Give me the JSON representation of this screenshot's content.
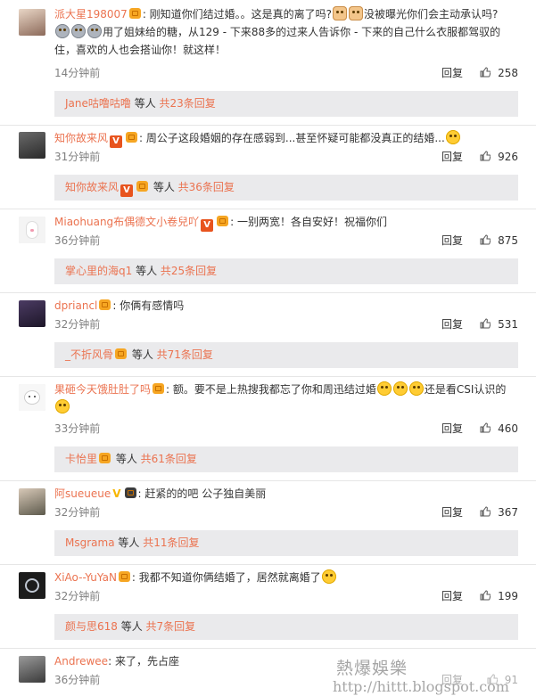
{
  "comments": [
    {
      "user": "派大星198007",
      "text_a": "刚知道你们结过婚。。这是真的离了吗?",
      "text_b": "没被曝光你们会主动承认吗?",
      "text_c": "用了姐妹给的糖，从129 - 下来88多的过来人告诉你 - 下来的自己什么衣服都驾驭的",
      "text_d": "住，喜欢的人也会搭讪你！就这样！",
      "time": "14分钟前",
      "reply": "回复",
      "likes": "258",
      "sub_user": "Jane咕噜咕噜",
      "sub_etc": " 等人 ",
      "sub_count": "共23条回复"
    },
    {
      "user": "知你故来风",
      "text_a": "周公子这段婚姻的存在感弱到...甚至怀疑可能都没真正的结婚...",
      "time": "31分钟前",
      "reply": "回复",
      "likes": "926",
      "sub_user": "知你故来风",
      "sub_etc": " 等人 ",
      "sub_count": "共36条回复"
    },
    {
      "user": "Miaohuang布偶德文小卷兒吖",
      "text_a": "一别两宽！各自安好！祝福你们",
      "time": "36分钟前",
      "reply": "回复",
      "likes": "875",
      "sub_user": "掌心里的海q1",
      "sub_etc": " 等人 ",
      "sub_count": "共25条回复"
    },
    {
      "user": "dpriancl",
      "text_a": "你俩有感情吗",
      "time": "32分钟前",
      "reply": "回复",
      "likes": "531",
      "sub_user": "_不折风骨",
      "sub_etc": " 等人 ",
      "sub_count": "共71条回复"
    },
    {
      "user": "果砸今天饿肚肚了吗",
      "text_a": "额。要不是上热搜我都忘了你和周迅结过婚",
      "text_b": "还是看CSI认识的",
      "time": "33分钟前",
      "reply": "回复",
      "likes": "460",
      "sub_user": "卡怡里",
      "sub_etc": " 等人 ",
      "sub_count": "共61条回复"
    },
    {
      "user": "阿sueueue",
      "text_a": "赶紧的的吧 公子独自美丽",
      "time": "32分钟前",
      "reply": "回复",
      "likes": "367",
      "sub_user": "Msgrama",
      "sub_etc": " 等人 ",
      "sub_count": "共11条回复"
    },
    {
      "user": "XiAo--YuYaN",
      "text_a": "我都不知道你俩结婚了，居然就离婚了",
      "time": "32分钟前",
      "reply": "回复",
      "likes": "199",
      "sub_user": "颜与思618",
      "sub_etc": " 等人 ",
      "sub_count": "共7条回复"
    },
    {
      "user": "Andrewee",
      "text_a": "来了，先占座",
      "time": "36分钟前",
      "reply": "回复",
      "likes": "91"
    }
  ],
  "watermark": {
    "title": "熱爆娛樂",
    "url": "http://hittt.blogspot.com"
  },
  "colors": {
    "username": "#eb7350",
    "subbox_bg": "#eaeaec",
    "time": "#808080"
  }
}
